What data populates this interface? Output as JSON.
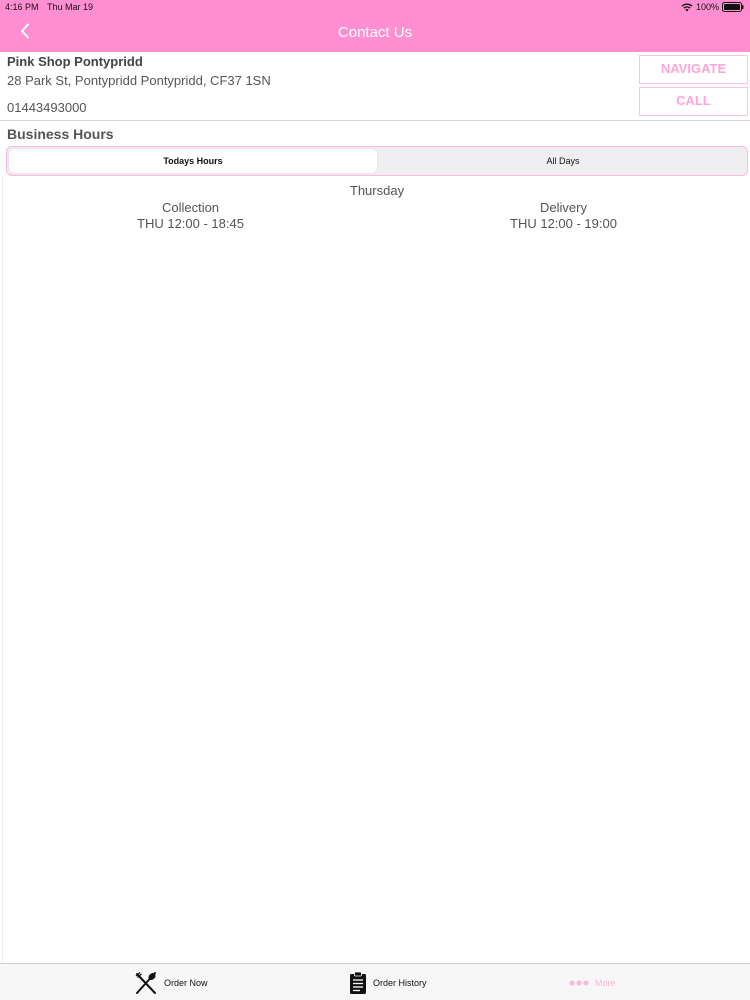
{
  "status_bar": {
    "time": "4:16 PM",
    "date": "Thu Mar 19",
    "battery": "100%"
  },
  "header": {
    "title": "Contact Us",
    "back_icon": "chevron-left-icon"
  },
  "store": {
    "name": "Pink Shop Pontypridd",
    "address": "28 Park St, Pontypridd Pontypridd, CF37 1SN",
    "phone": "01443493000"
  },
  "actions": {
    "navigate_label": "NAVIGATE",
    "call_label": "CALL"
  },
  "business_hours": {
    "title": "Business Hours",
    "tabs": [
      {
        "label": "Todays Hours",
        "selected": true
      },
      {
        "label": "All Days",
        "selected": false
      }
    ],
    "day": "Thursday",
    "collection": {
      "label": "Collection",
      "hours": "THU 12:00 - 18:45"
    },
    "delivery": {
      "label": "Delivery",
      "hours": "THU 12:00 - 19:00"
    }
  },
  "tabbar": {
    "items": [
      {
        "label": "Order Now",
        "icon": "fork-knife-icon"
      },
      {
        "label": "Order History",
        "icon": "clipboard-icon"
      },
      {
        "label": "More",
        "icon": "more-dots-icon"
      }
    ]
  },
  "colors": {
    "brand_pink": "#ff8fd0",
    "button_text_pink": "#ffa4d8",
    "button_border_pink": "#ffc2e4",
    "inactive_tab_pink": "#ffb3dd"
  }
}
